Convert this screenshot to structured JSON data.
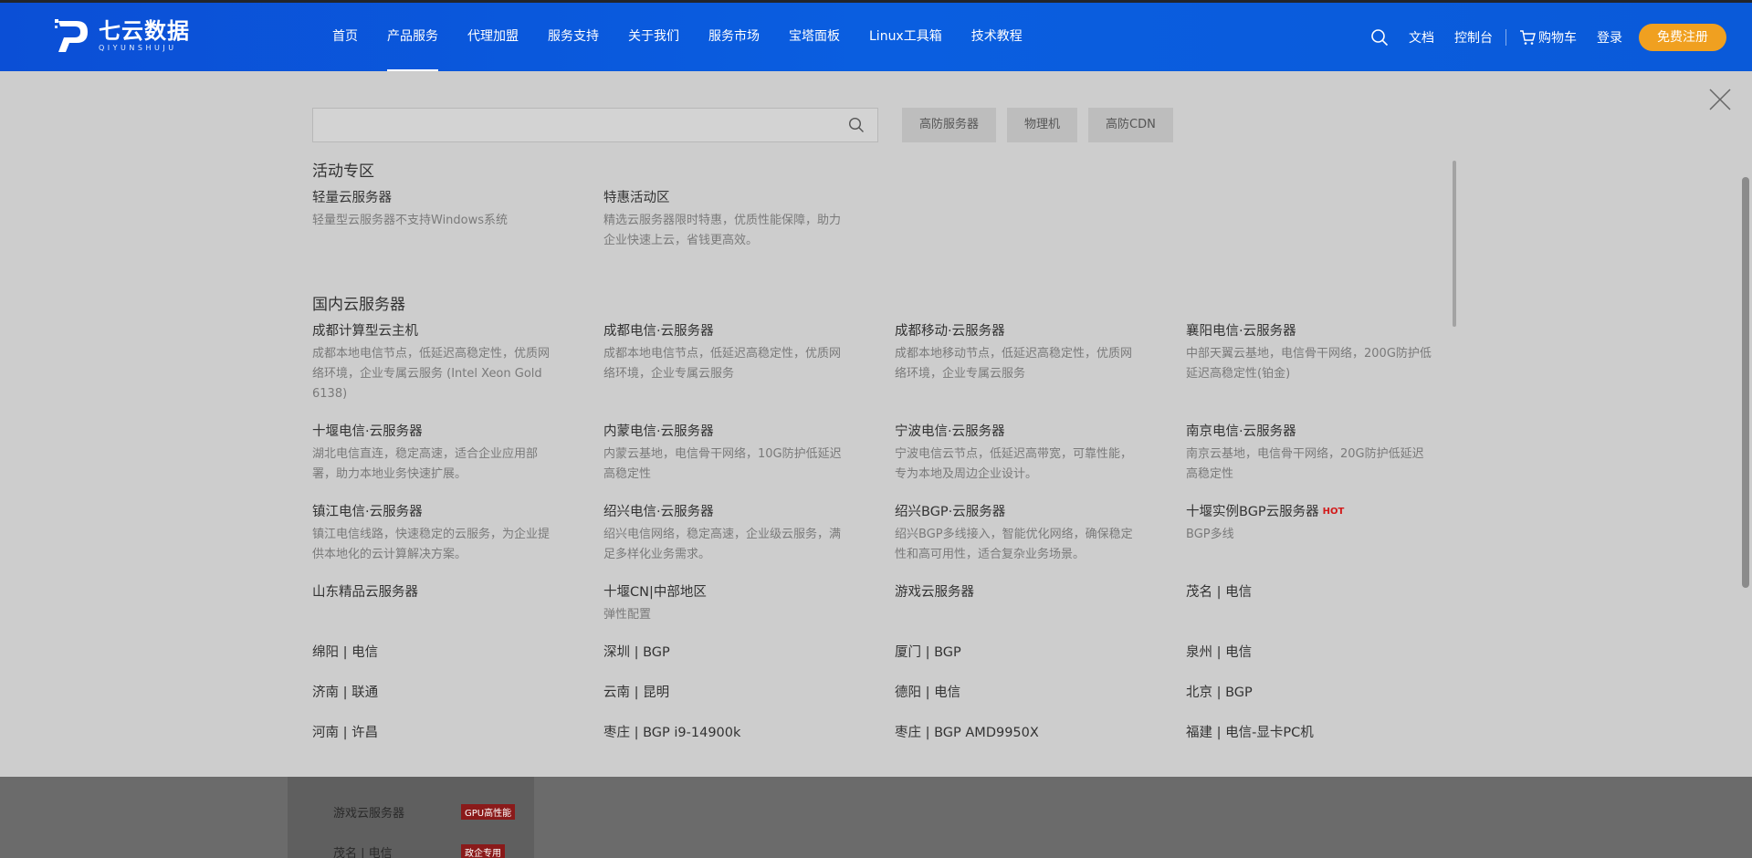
{
  "header": {
    "logo_cn": "七云数据",
    "logo_en": "QIYUNSHUJU",
    "nav": [
      "首页",
      "产品服务",
      "代理加盟",
      "服务支持",
      "关于我们",
      "服务市场",
      "宝塔面板",
      "Linux工具箱",
      "技术教程"
    ],
    "active_nav": "产品服务",
    "right": {
      "docs": "文档",
      "console": "控制台",
      "cart": "购物车",
      "login": "登录",
      "register": "免费注册"
    },
    "colors": {
      "bar": "#0a56dc",
      "register_bg": "#f0a020"
    }
  },
  "search": {
    "placeholder": ""
  },
  "quick_tags": [
    "高防服务器",
    "物理机",
    "高防CDN"
  ],
  "sections": {
    "activity": {
      "title": "活动专区",
      "items": [
        {
          "title": "轻量云服务器",
          "desc": "轻量型云服务器不支持Windows系统"
        },
        {
          "title": "特惠活动区",
          "desc": "精选云服务器限时特惠，优质性能保障，助力企业快速上云，省钱更高效。"
        }
      ]
    },
    "domestic": {
      "title": "国内云服务器",
      "items": [
        {
          "title": "成都计算型云主机",
          "desc": "成都本地电信节点，低延迟高稳定性，优质网络环境，企业专属云服务 (Intel Xeon Gold 6138)"
        },
        {
          "title": "成都电信·云服务器",
          "desc": "成都本地电信节点，低延迟高稳定性，优质网络环境，企业专属云服务"
        },
        {
          "title": "成都移动·云服务器",
          "desc": "成都本地移动节点，低延迟高稳定性，优质网络环境，企业专属云服务"
        },
        {
          "title": "襄阳电信·云服务器",
          "desc": "中部天翼云基地，电信骨干网络，200G防护低延迟高稳定性(铂金)"
        },
        {
          "title": "十堰电信·云服务器",
          "desc": "湖北电信直连，稳定高速，适合企业应用部署，助力本地业务快速扩展。"
        },
        {
          "title": "内蒙电信·云服务器",
          "desc": "内蒙云基地，电信骨干网络，10G防护低延迟高稳定性"
        },
        {
          "title": "宁波电信·云服务器",
          "desc": "宁波电信云节点，低延迟高带宽，可靠性能，专为本地及周边企业设计。"
        },
        {
          "title": "南京电信·云服务器",
          "desc": "南京云基地，电信骨干网络，20G防护低延迟高稳定性"
        },
        {
          "title": "镇江电信·云服务器",
          "desc": "镇江电信线路，快速稳定的云服务，为企业提供本地化的云计算解决方案。"
        },
        {
          "title": "绍兴电信·云服务器",
          "desc": "绍兴电信网络，稳定高速，企业级云服务，满足多样化业务需求。"
        },
        {
          "title": "绍兴BGP·云服务器",
          "desc": "绍兴BGP多线接入，智能优化网络，确保稳定性和高可用性，适合复杂业务场景。"
        },
        {
          "title": "十堰实例BGP云服务器",
          "desc": "BGP多线",
          "badge": "HOT"
        },
        {
          "title": "山东精品云服务器",
          "desc": ""
        },
        {
          "title": "十堰CN|中部地区",
          "desc": "弹性配置"
        },
        {
          "title": "游戏云服务器",
          "desc": ""
        },
        {
          "title": "茂名 | 电信",
          "desc": ""
        },
        {
          "title": "绵阳 | 电信",
          "desc": ""
        },
        {
          "title": "深圳 | BGP",
          "desc": ""
        },
        {
          "title": "厦门 | BGP",
          "desc": ""
        },
        {
          "title": "泉州 | 电信",
          "desc": ""
        },
        {
          "title": "济南 | 联通",
          "desc": ""
        },
        {
          "title": "云南 | 昆明",
          "desc": ""
        },
        {
          "title": "德阳 | 电信",
          "desc": ""
        },
        {
          "title": "北京 | BGP",
          "desc": ""
        },
        {
          "title": "河南 | 许昌",
          "desc": ""
        },
        {
          "title": "枣庄 | BGP i9-14900k",
          "desc": ""
        },
        {
          "title": "枣庄 | BGP AMD9950X",
          "desc": ""
        },
        {
          "title": "福建 | 电信-显卡PC机",
          "desc": ""
        }
      ]
    }
  },
  "behind": {
    "rows": [
      {
        "label": "游戏云服务器",
        "badge": "GPU高性能"
      },
      {
        "label": "茂名 | 电信",
        "badge": "政企专用"
      }
    ]
  }
}
